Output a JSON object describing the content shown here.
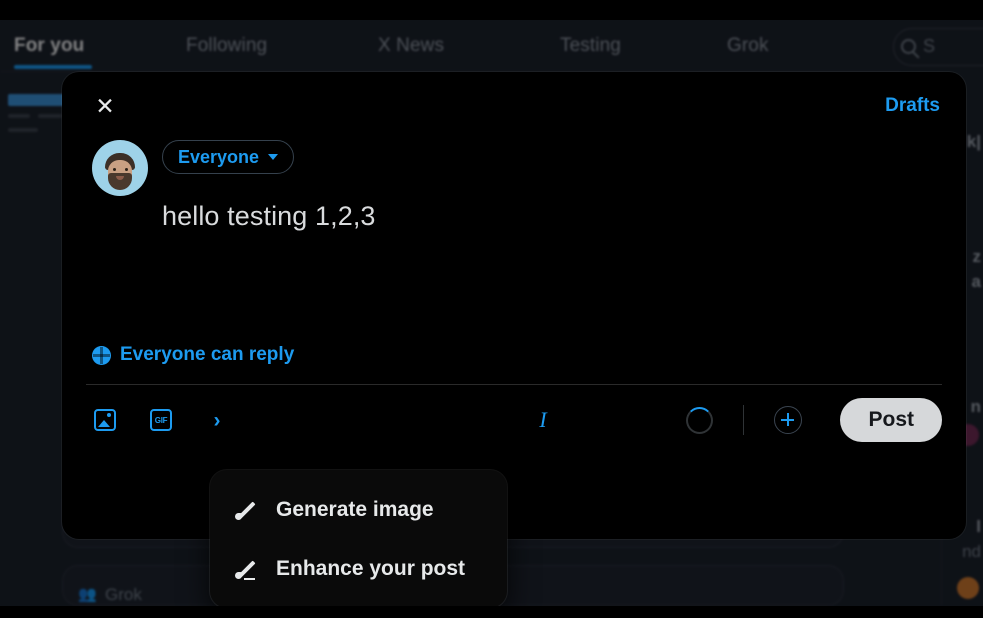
{
  "background": {
    "tabs": [
      {
        "label": "For you",
        "active": true
      },
      {
        "label": "Following",
        "active": false
      },
      {
        "label": "X News",
        "active": false
      },
      {
        "label": "Testing",
        "active": false
      },
      {
        "label": "Grok",
        "active": false
      }
    ],
    "search": {
      "icon": "search-icon",
      "label": "S"
    },
    "grok_card_label": "Grok",
    "right_fragments": [
      "k|",
      "z",
      "a",
      "n",
      "l",
      "nd"
    ]
  },
  "modal": {
    "close_label": "✕",
    "drafts_label": "Drafts",
    "audience": {
      "label": "Everyone",
      "icon": "chevron-down-icon"
    },
    "compose_text": "hello testing 1,2,3",
    "reply_setting": {
      "icon": "globe-icon",
      "label": "Everyone can reply"
    },
    "toolbar": {
      "media_icon": "image-icon",
      "gif_icon_label": "GIF",
      "grok_icon_label": "›",
      "italic_icon_label": "I",
      "plus_icon": "plus-icon",
      "post_label": "Post"
    }
  },
  "popup_menu": {
    "items": [
      {
        "label": "Generate image",
        "icon": "paintbrush-icon"
      },
      {
        "label": "Enhance your post",
        "icon": "pencil-icon"
      }
    ]
  },
  "colors": {
    "accent": "#1d9bf0",
    "modal_bg": "#000000",
    "page_bg": "#1b212b",
    "post_button_bg": "#d6d8da",
    "text_primary": "#e7e9ea",
    "text_secondary": "#8a929e"
  }
}
